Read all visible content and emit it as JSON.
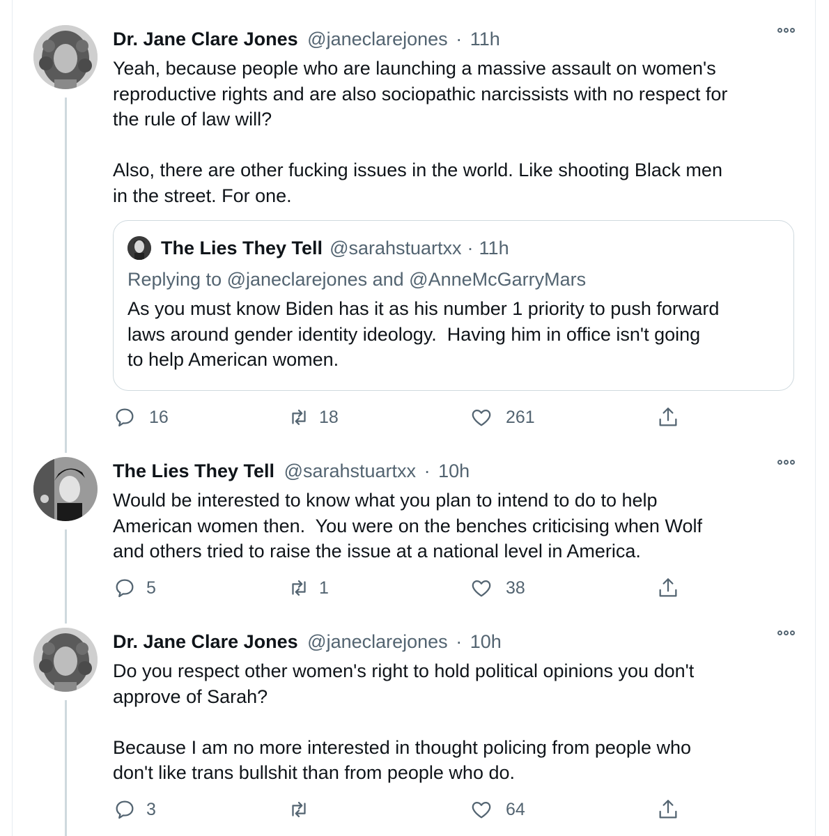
{
  "tweets": [
    {
      "name": "Dr. Jane Clare Jones",
      "handle": "@janeclarejones",
      "time": "11h",
      "separator": "·",
      "text": "Yeah, because people who are launching a massive assault on women's\nreproductive rights and are also sociopathic narcissists with no respect for\nthe rule of law will?\n\nAlso, there are other fucking issues in the world. Like shooting Black men\nin the street. For one.",
      "quote": {
        "name": "The Lies They Tell",
        "handle": "@sarahstuartxx",
        "time": "11h",
        "separator": "·",
        "replying": "Replying to @janeclarejones and @AnneMcGarryMars",
        "text": "As you must know Biden has it as his number 1 priority to push forward\nlaws around gender identity ideology.  Having him in office isn't going\nto help American women."
      },
      "replies": "16",
      "retweets": "18",
      "likes": "261",
      "avatar_icon": "curly-hair-portrait"
    },
    {
      "name": "The Lies They Tell",
      "handle": "@sarahstuartxx",
      "time": "10h",
      "separator": "·",
      "text": "Would be interested to know what you plan to intend to do to help\nAmerican women then.  You were on the benches criticising when Wolf\nand others tried to raise the issue at a national level in America.",
      "replies": "5",
      "retweets": "1",
      "likes": "38",
      "avatar_icon": "black-and-white-portrait"
    },
    {
      "name": "Dr. Jane Clare Jones",
      "handle": "@janeclarejones",
      "time": "10h",
      "separator": "·",
      "text": "Do you respect other women's right to hold political opinions you don't\napprove of Sarah?\n\nBecause I am no more interested in thought policing from people who\ndon't like trans bullshit than from people who do.",
      "replies": "3",
      "retweets": "",
      "likes": "64",
      "avatar_icon": "curly-hair-portrait"
    }
  ],
  "colors": {
    "text": "#0f1419",
    "secondary": "#536471",
    "border": "#cfd9de",
    "thread_line": "#cfd9de"
  }
}
